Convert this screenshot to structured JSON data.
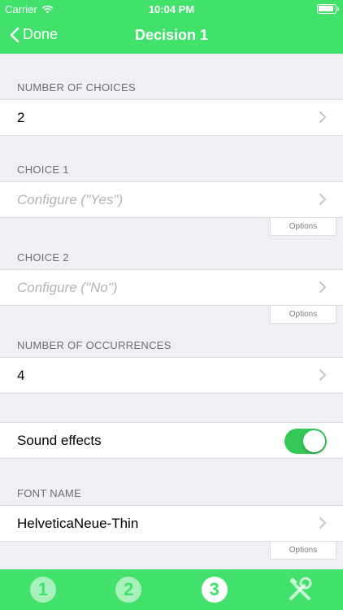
{
  "status_bar": {
    "carrier": "Carrier",
    "time": "10:04 PM"
  },
  "nav": {
    "back_label": "Done",
    "title": "Decision 1"
  },
  "sections": {
    "number_of_choices": {
      "header": "NUMBER OF CHOICES",
      "value": "2"
    },
    "choice1": {
      "header": "CHOICE 1",
      "placeholder": "Configure (\"Yes\")",
      "options_label": "Options"
    },
    "choice2": {
      "header": "CHOICE 2",
      "placeholder": "Configure (\"No\")",
      "options_label": "Options"
    },
    "number_of_occurrences": {
      "header": "NUMBER OF OCCURRENCES",
      "value": "4"
    },
    "sound_effects": {
      "label": "Sound effects",
      "enabled": true
    },
    "font_name": {
      "header": "FONT NAME",
      "value": "HelveticaNeue-Thin",
      "options_label": "Options"
    }
  },
  "tabbar": {
    "tabs": [
      {
        "label": "1"
      },
      {
        "label": "2"
      },
      {
        "label": "3"
      },
      {
        "icon": "tools-icon"
      }
    ],
    "active_index": 2
  },
  "colors": {
    "accent": "#41e16b",
    "toggle_on": "#34c759",
    "background": "#efeff4"
  }
}
